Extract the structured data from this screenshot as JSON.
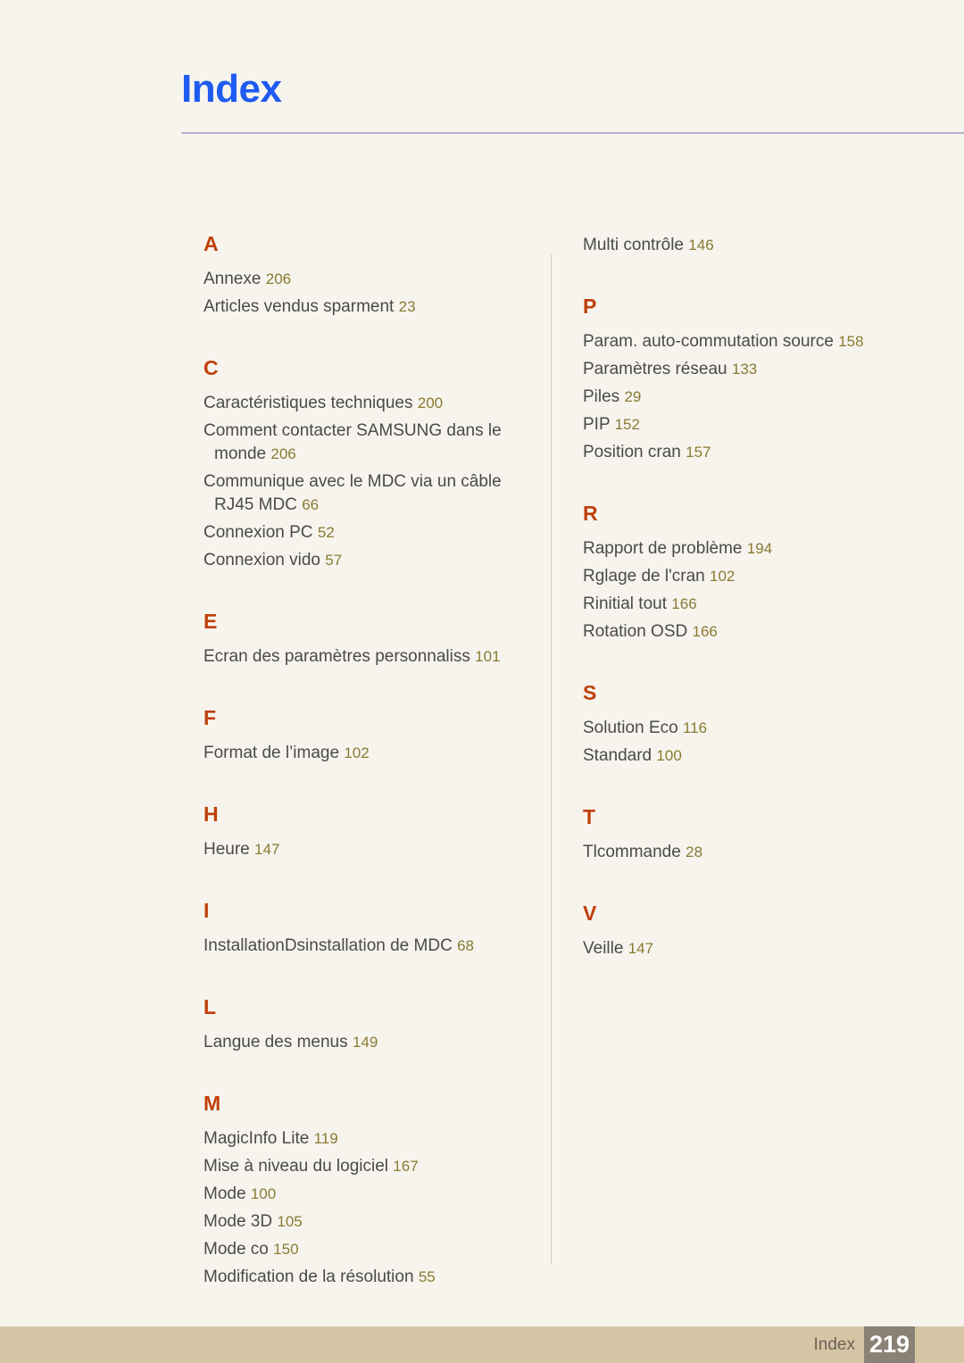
{
  "page": {
    "title": "Index"
  },
  "footer": {
    "label": "Index",
    "page_number": "219"
  },
  "colors": {
    "background": "#f6f4ed",
    "title": "#1e5bf0",
    "title_rule": "#b7b3cf",
    "letter_heading": "#c0400a",
    "entry_text": "#4a4a4a",
    "page_number": "#8a7a33",
    "column_divider": "#dcc9bd",
    "footer_band": "#d4c6a4",
    "footer_label": "#6e6155",
    "footer_box": "#8c8175",
    "footer_number": "#ffffff"
  },
  "columns": {
    "left": [
      {
        "letter": "A",
        "entries": [
          {
            "title": "Annexe",
            "page": "206"
          },
          {
            "title": "Articles vendus sparment",
            "page": "23"
          }
        ]
      },
      {
        "letter": "C",
        "entries": [
          {
            "title": "Caractéristiques techniques",
            "page": "200"
          },
          {
            "title": "Comment contacter SAMSUNG dans le monde",
            "page": "206"
          },
          {
            "title": "Communique avec le MDC via un câble RJ45 MDC",
            "page": "66"
          },
          {
            "title": "Connexion PC",
            "page": "52"
          },
          {
            "title": "Connexion vido",
            "page": "57"
          }
        ]
      },
      {
        "letter": "E",
        "entries": [
          {
            "title": "Ecran des paramètres personnaliss",
            "page": "101"
          }
        ]
      },
      {
        "letter": "F",
        "entries": [
          {
            "title": "Format de l’image",
            "page": "102"
          }
        ]
      },
      {
        "letter": "H",
        "entries": [
          {
            "title": "Heure",
            "page": "147"
          }
        ]
      },
      {
        "letter": "I",
        "entries": [
          {
            "title": "InstallationDsinstallation de MDC",
            "page": "68"
          }
        ]
      },
      {
        "letter": "L",
        "entries": [
          {
            "title": "Langue des menus",
            "page": "149"
          }
        ]
      },
      {
        "letter": "M",
        "entries": [
          {
            "title": "MagicInfo Lite",
            "page": "119"
          },
          {
            "title": "Mise à niveau du logiciel",
            "page": "167"
          },
          {
            "title": "Mode",
            "page": "100"
          },
          {
            "title": "Mode 3D",
            "page": "105"
          },
          {
            "title": "Mode co",
            "page": "150"
          },
          {
            "title": "Modification de la résolution",
            "page": "55"
          }
        ]
      }
    ],
    "right_orphan": {
      "title": "Multi contrôle",
      "page": "146"
    },
    "right": [
      {
        "letter": "P",
        "entries": [
          {
            "title": "Param. auto-commutation source",
            "page": "158"
          },
          {
            "title": "Paramètres réseau",
            "page": "133"
          },
          {
            "title": "Piles",
            "page": "29"
          },
          {
            "title": "PIP",
            "page": "152"
          },
          {
            "title": "Position cran",
            "page": "157"
          }
        ]
      },
      {
        "letter": "R",
        "entries": [
          {
            "title": "Rapport de problème",
            "page": "194"
          },
          {
            "title": "Rglage de l'cran",
            "page": "102"
          },
          {
            "title": "Rinitial tout",
            "page": "166"
          },
          {
            "title": "Rotation OSD",
            "page": "166"
          }
        ]
      },
      {
        "letter": "S",
        "entries": [
          {
            "title": "Solution Eco",
            "page": "116"
          },
          {
            "title": "Standard",
            "page": "100"
          }
        ]
      },
      {
        "letter": "T",
        "entries": [
          {
            "title": "Tlcommande",
            "page": "28"
          }
        ]
      },
      {
        "letter": "V",
        "entries": [
          {
            "title": "Veille",
            "page": "147"
          }
        ]
      }
    ]
  }
}
